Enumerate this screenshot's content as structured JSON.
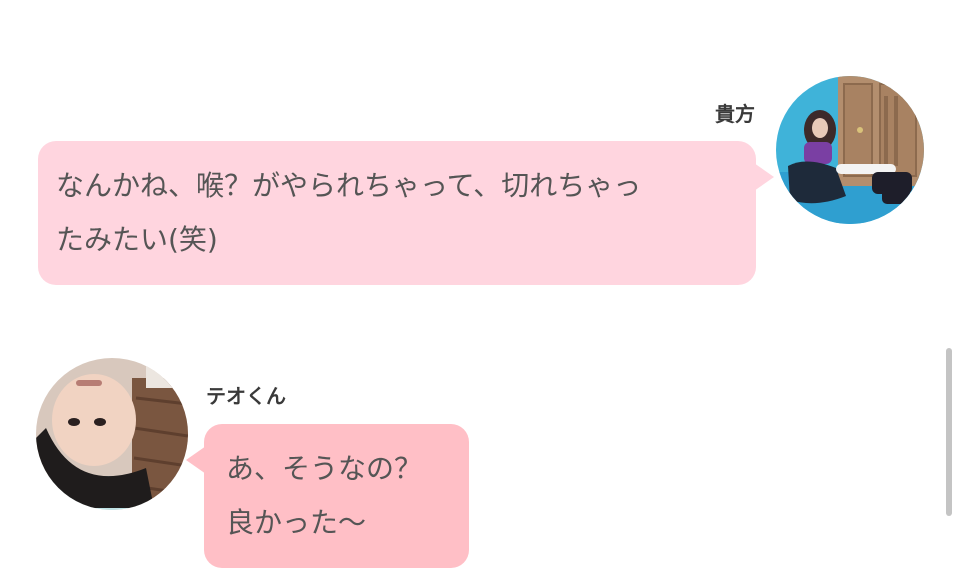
{
  "messages": [
    {
      "sender": "貴方",
      "side": "right",
      "lines": [
        "なんかね、喉？がやられちゃって、切れちゃっ",
        "たみたい(笑)"
      ],
      "bubble_color": "#ffd5df"
    },
    {
      "sender": "テオくん",
      "side": "left",
      "lines": [
        "あ、そうなの？",
        "良かった〜"
      ],
      "bubble_color": "#ffbfc6"
    }
  ],
  "colors": {
    "background": "#ffffff",
    "text": "#555555",
    "name_text": "#3a3a3a",
    "scrollbar": "#c4c4c4"
  },
  "scroll": {
    "position_fraction": 0.6
  }
}
